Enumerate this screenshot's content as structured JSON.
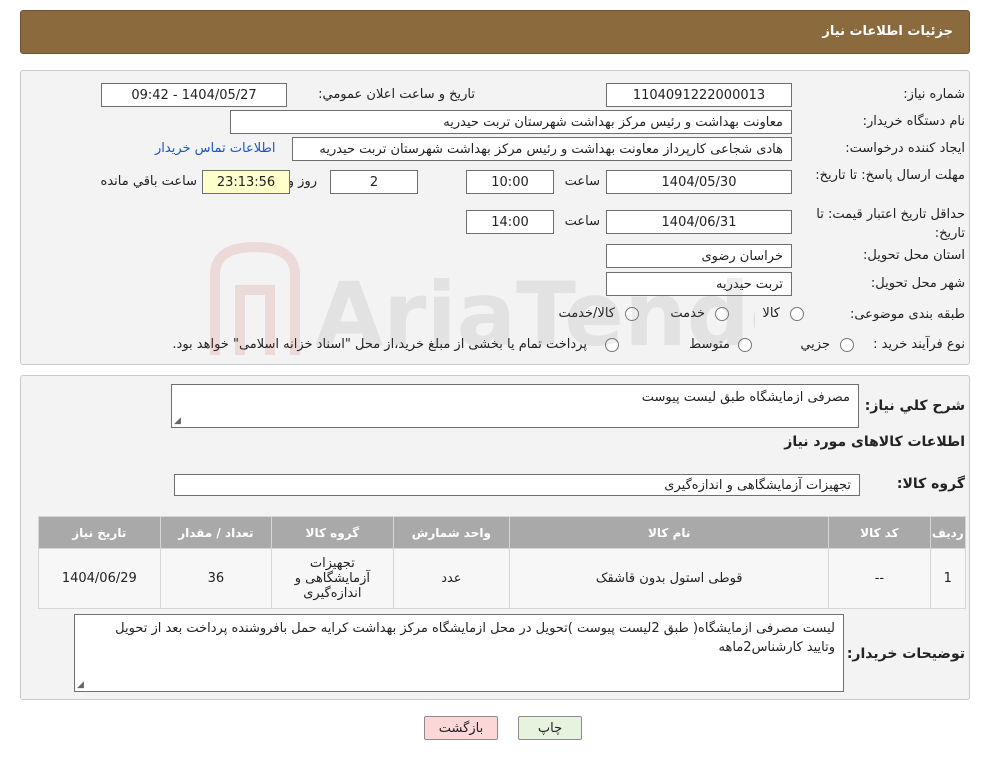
{
  "header": {
    "title": "جزئیات اطلاعات نیاز"
  },
  "form": {
    "need_number_label": "شماره نیاز:",
    "need_number": "1104091222000013",
    "announce_label": "تاریخ و ساعت اعلان عمومي:",
    "announce_value": "1404/05/27 - 09:42",
    "buyer_org_label": "نام دستگاه خريدار:",
    "buyer_org": "معاونت بهداشت و رئیس مرکز بهداشت شهرستان تربت حیدریه",
    "creator_label": "ایجاد کننده درخواست:",
    "creator": "هادی شجاعی کارپرداز معاونت بهداشت و رئیس مرکز بهداشت شهرستان تربت حیدریه",
    "contact_link": "اطلاعات تماس خريدار",
    "deadline_label": "مهلت ارسال پاسخ: تا تاریخ:",
    "deadline_date": "1404/05/30",
    "time_label": "ساعت",
    "deadline_time": "10:00",
    "days": "2",
    "days_label": "روز و",
    "remaining_time": "23:13:56",
    "remaining_label": "ساعت باقي مانده",
    "validity_label": "حداقل تاريخ اعتبار قيمت: تا تاریخ:",
    "validity_date": "1404/06/31",
    "validity_time": "14:00",
    "province_label": "استان محل تحویل:",
    "province": "خراسان رضوی",
    "city_label": "شهر محل تحویل:",
    "city": "تربت حیدریه",
    "category_label": "طبقه بندی موضوعی:",
    "category_options": [
      "کالا",
      "خدمت",
      "کالا/خدمت"
    ],
    "process_label": "نوع فرآیند خرید :",
    "process_options": [
      "جزیي",
      "متوسط"
    ],
    "process_note": "پرداخت تمام یا بخشی از مبلغ خرید،از محل \"اسناد خزانه اسلامی\" خواهد بود."
  },
  "details": {
    "summary_label": "شرح كلي نياز:",
    "summary": "مصرفی ازمایشگاه طبق لیست پیوست",
    "goods_heading": "اطلاعات کالاهای مورد نیاز",
    "group_label": "گروه کالا:",
    "group": "تجهیزات آزمایشگاهی و اندازه‌گیری",
    "table": {
      "headers": [
        "رديف",
        "کد کالا",
        "نام کالا",
        "واحد شمارش",
        "گروه کالا",
        "تعداد / مقدار",
        "تاریخ نیاز"
      ],
      "rows": [
        [
          "1",
          "--",
          "قوطی استول بدون قاشقک",
          "عدد",
          "تجهیزات آزمایشگاهی و اندازه‌گیری",
          "36",
          "1404/06/29"
        ]
      ]
    },
    "buyer_notes_label": "توضیحات خریدار:",
    "buyer_notes": "لیست مصرفی ازمایشگاه( طبق 2لیست پیوست )تحویل در محل ازمایشگاه مرکز بهداشت کرایه حمل بافروشنده پرداخت بعد از تحویل وتایید کارشناس2ماهه"
  },
  "buttons": {
    "print": "چاپ",
    "back": "بازگشت"
  },
  "watermark": {
    "text": "AriaTender.neT"
  }
}
